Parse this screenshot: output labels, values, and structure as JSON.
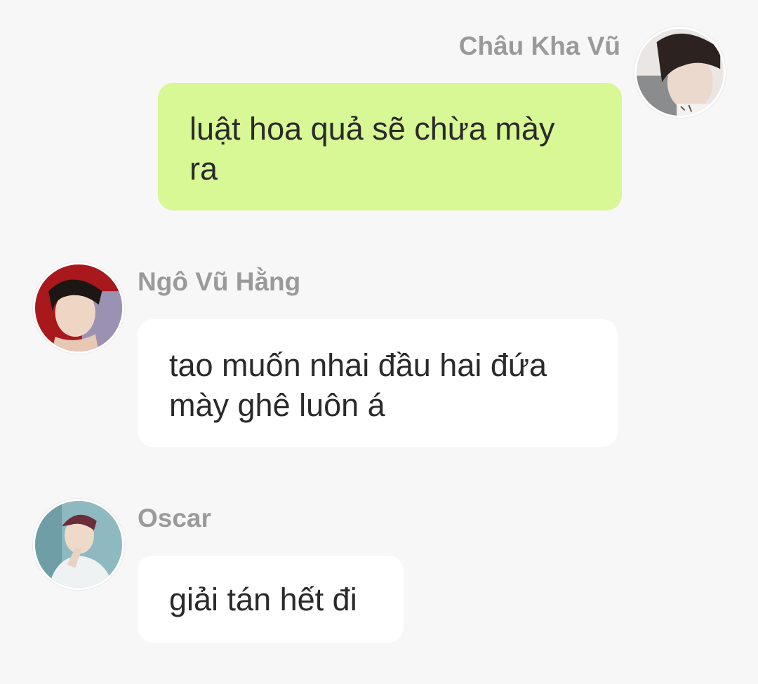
{
  "messages": [
    {
      "sender": "Châu Kha Vũ",
      "text": "luật hoa quả sẽ chừa mày ra",
      "side": "right",
      "avatar_icon": "person-avatar-icon"
    },
    {
      "sender": "Ngô Vũ Hằng",
      "text": "tao muốn nhai đầu hai đứa mày ghê luôn á",
      "side": "left",
      "avatar_icon": "person-avatar-icon"
    },
    {
      "sender": "Oscar",
      "text": "giải tán hết đi",
      "side": "left",
      "avatar_icon": "person-avatar-icon"
    }
  ],
  "colors": {
    "background": "#f7f7f7",
    "own_bubble": "#d8f795",
    "other_bubble": "#ffffff",
    "sender_name": "#9a9a9a",
    "message_text": "#2a2a2a"
  }
}
